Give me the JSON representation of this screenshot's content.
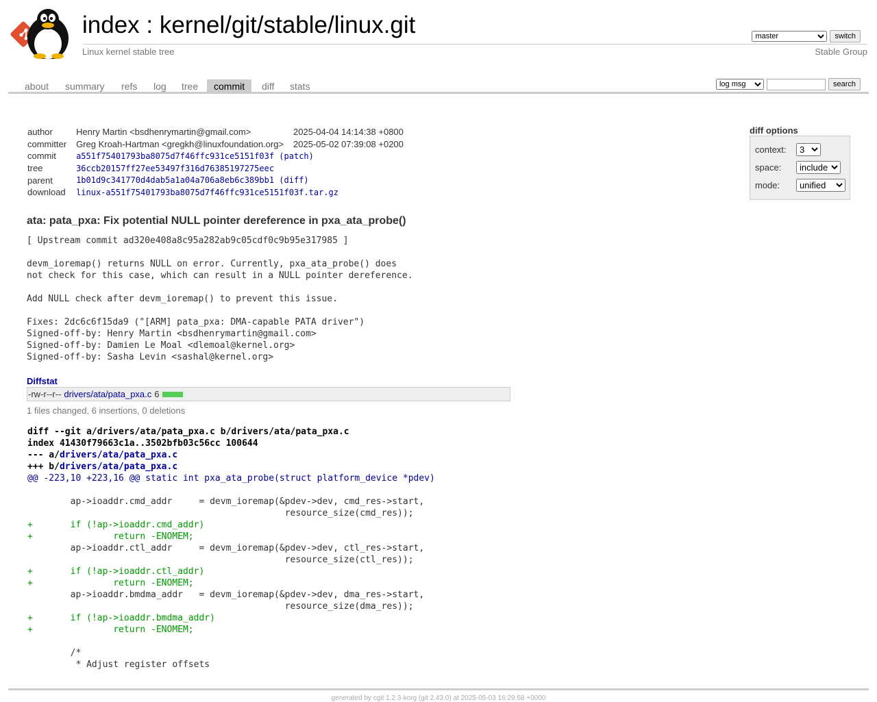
{
  "header": {
    "index_label": "index",
    "separator": " : ",
    "repo_path": "kernel/git/stable/linux.git",
    "description": "Linux kernel stable tree",
    "owner": "Stable Group",
    "branch_selected": "master",
    "switch_label": "switch",
    "logo_icon": "tux-penguin-logo"
  },
  "tabs": [
    {
      "label": "about",
      "active": false
    },
    {
      "label": "summary",
      "active": false
    },
    {
      "label": "refs",
      "active": false
    },
    {
      "label": "log",
      "active": false
    },
    {
      "label": "tree",
      "active": false
    },
    {
      "label": "commit",
      "active": true
    },
    {
      "label": "diff",
      "active": false
    },
    {
      "label": "stats",
      "active": false
    }
  ],
  "search": {
    "mode": "log msg",
    "value": "",
    "button": "search"
  },
  "commit_info": {
    "author_label": "author",
    "author": "Henry Martin <bsdhenrymartin@gmail.com>",
    "author_date": "2025-04-04 14:14:38 +0800",
    "committer_label": "committer",
    "committer": "Greg Kroah-Hartman <gregkh@linuxfoundation.org>",
    "committer_date": "2025-05-02 07:39:08 +0200",
    "commit_label": "commit",
    "commit": "a551f75401793ba8075d7f46ffc931ce5151f03f",
    "patch_link": "patch",
    "tree_label": "tree",
    "tree": "36ccb20157ff27ee53497f316d76385197275eec",
    "parent_label": "parent",
    "parent": "1b01d9c341770d4dab5a1a04a706a8eb6c389bb1",
    "diff_link": "diff",
    "download_label": "download",
    "download": "linux-a551f75401793ba8075d7f46ffc931ce5151f03f.tar.gz"
  },
  "diff_options": {
    "title": "diff options",
    "context_label": "context:",
    "context_value": "3",
    "space_label": "space:",
    "space_value": "include",
    "mode_label": "mode:",
    "mode_value": "unified"
  },
  "subject": "ata: pata_pxa: Fix potential NULL pointer dereference in pxa_ata_probe()",
  "message": "[ Upstream commit ad320e408a8c95a282ab9c05cdf0c9b95e317985 ]\n\ndevm_ioremap() returns NULL on error. Currently, pxa_ata_probe() does\nnot check for this case, which can result in a NULL pointer dereference.\n\nAdd NULL check after devm_ioremap() to prevent this issue.\n\nFixes: 2dc6c6f15da9 (\"[ARM] pata_pxa: DMA-capable PATA driver\")\nSigned-off-by: Henry Martin <bsdhenrymartin@gmail.com>\nSigned-off-by: Damien Le Moal <dlemoal@kernel.org>\nSigned-off-by: Sasha Levin <sashal@kernel.org>",
  "diffstat": {
    "title": "Diffstat",
    "mode": "-rw-r--r--",
    "file": "drivers/ata/pata_pxa.c",
    "changes": "6",
    "insertion_fraction": 1.0,
    "summary": "1 files changed, 6 insertions, 0 deletions"
  },
  "diff": {
    "head1": "diff --git a/drivers/ata/pata_pxa.c b/drivers/ata/pata_pxa.c",
    "head2": "index 41430f79663c1a..3502bfb03c56cc 100644",
    "minus_prefix": "--- a/",
    "minus_file": "drivers/ata/pata_pxa.c",
    "plus_prefix": "+++ b/",
    "plus_file": "drivers/ata/pata_pxa.c",
    "hunk": "@@ -223,10 +223,16 @@ static int pxa_ata_probe(struct platform_device *pdev)",
    "lines": [
      {
        "type": "ctx",
        "text": " "
      },
      {
        "type": "ctx",
        "text": " \tap->ioaddr.cmd_addr\t= devm_ioremap(&pdev->dev, cmd_res->start,"
      },
      {
        "type": "ctx",
        "text": " \t\t\t\t\t\tresource_size(cmd_res));"
      },
      {
        "type": "add",
        "text": "+\tif (!ap->ioaddr.cmd_addr)"
      },
      {
        "type": "add",
        "text": "+\t\treturn -ENOMEM;"
      },
      {
        "type": "ctx",
        "text": " \tap->ioaddr.ctl_addr\t= devm_ioremap(&pdev->dev, ctl_res->start,"
      },
      {
        "type": "ctx",
        "text": " \t\t\t\t\t\tresource_size(ctl_res));"
      },
      {
        "type": "add",
        "text": "+\tif (!ap->ioaddr.ctl_addr)"
      },
      {
        "type": "add",
        "text": "+\t\treturn -ENOMEM;"
      },
      {
        "type": "ctx",
        "text": " \tap->ioaddr.bmdma_addr\t= devm_ioremap(&pdev->dev, dma_res->start,"
      },
      {
        "type": "ctx",
        "text": " \t\t\t\t\t\tresource_size(dma_res));"
      },
      {
        "type": "add",
        "text": "+\tif (!ap->ioaddr.bmdma_addr)"
      },
      {
        "type": "add",
        "text": "+\t\treturn -ENOMEM;"
      },
      {
        "type": "ctx",
        "text": " "
      },
      {
        "type": "ctx",
        "text": " \t/*"
      },
      {
        "type": "ctx",
        "text": " \t * Adjust register offsets"
      }
    ]
  },
  "footer": "generated by cgit 1.2.3-korg (git 2.43.0) at 2025-05-03 16:29:58 +0000",
  "colors": {
    "link": "#00009c",
    "added": "#009900",
    "diffstat_bar": "#55cc55",
    "tab_active_bg": "#cccccc"
  }
}
